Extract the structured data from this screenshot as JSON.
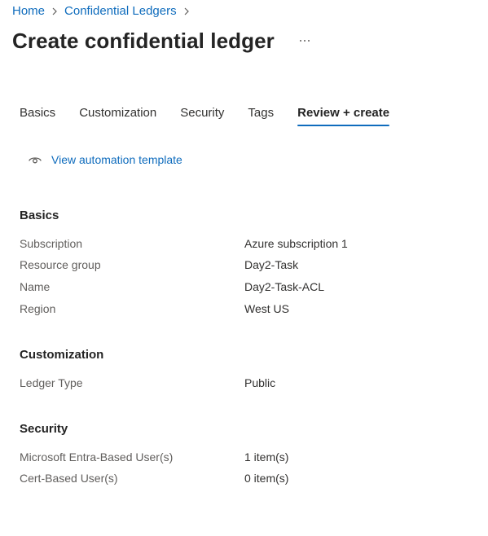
{
  "breadcrumb": {
    "items": [
      "Home",
      "Confidential Ledgers"
    ]
  },
  "header": {
    "title": "Create confidential ledger",
    "more_label": "..."
  },
  "tabs": [
    {
      "label": "Basics",
      "active": false
    },
    {
      "label": "Customization",
      "active": false
    },
    {
      "label": "Security",
      "active": false
    },
    {
      "label": "Tags",
      "active": false
    },
    {
      "label": "Review + create",
      "active": true
    }
  ],
  "automation": {
    "icon": "eye-icon",
    "label": "View automation template"
  },
  "sections": {
    "basics": {
      "heading": "Basics",
      "rows": [
        {
          "key": "Subscription",
          "value": "Azure subscription 1"
        },
        {
          "key": "Resource group",
          "value": "Day2-Task"
        },
        {
          "key": "Name",
          "value": "Day2-Task-ACL"
        },
        {
          "key": "Region",
          "value": "West US"
        }
      ]
    },
    "customization": {
      "heading": "Customization",
      "rows": [
        {
          "key": "Ledger Type",
          "value": "Public"
        }
      ]
    },
    "security": {
      "heading": "Security",
      "rows": [
        {
          "key": "Microsoft Entra-Based User(s)",
          "value": "1 item(s)"
        },
        {
          "key": "Cert-Based User(s)",
          "value": "0 item(s)"
        }
      ]
    }
  },
  "colors": {
    "link": "#0f6cbd",
    "active_tab_underline": "#0f6cbd",
    "label_gray": "#605e5c",
    "text": "#323130"
  }
}
